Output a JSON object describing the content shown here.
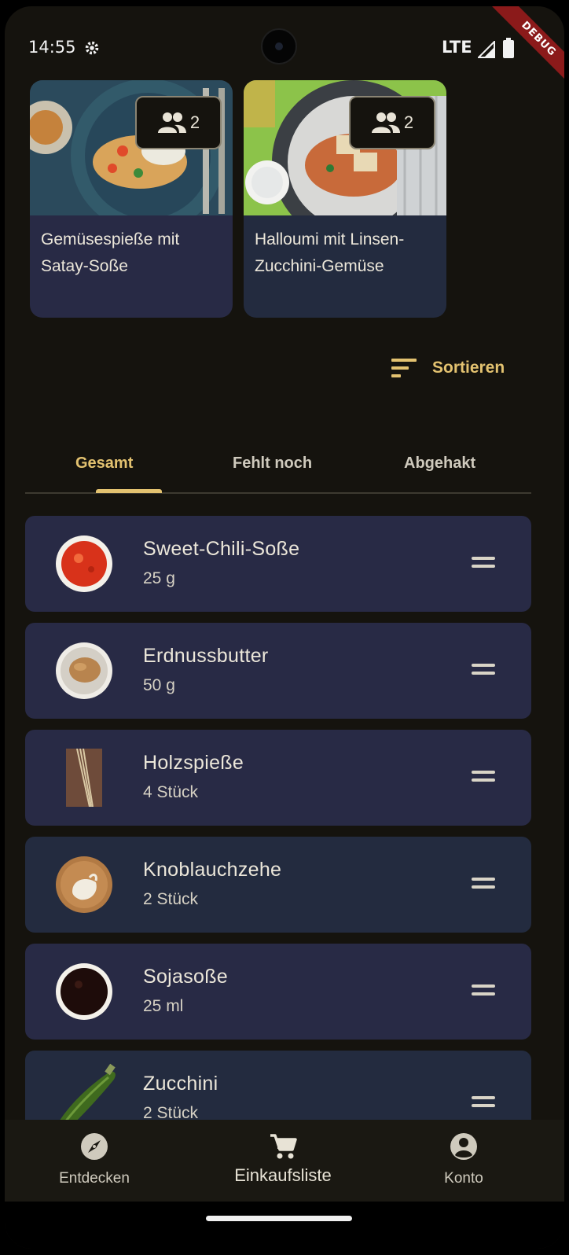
{
  "status_bar": {
    "time": "14:55",
    "network": "LTE",
    "debug_banner": "DEBUG"
  },
  "recipes": [
    {
      "title": "Gemüsespieße mit Satay-Soße",
      "servings": "2"
    },
    {
      "title": "Halloumi mit Linsen-Zucchini-Gemüse",
      "servings": "2"
    }
  ],
  "sort": {
    "label": "Sortieren",
    "icon": "sort-icon"
  },
  "tabs": [
    {
      "label": "Gesamt",
      "active": true
    },
    {
      "label": "Fehlt noch",
      "active": false
    },
    {
      "label": "Abgehakt",
      "active": false
    }
  ],
  "ingredients": [
    {
      "name": "Sweet-Chili-Soße",
      "quantity": "25 g"
    },
    {
      "name": "Erdnussbutter",
      "quantity": "50 g"
    },
    {
      "name": "Holzspieße",
      "quantity": "4 Stück"
    },
    {
      "name": "Knoblauchzehe",
      "quantity": "2 Stück"
    },
    {
      "name": "Sojasoße",
      "quantity": "25 ml"
    },
    {
      "name": "Zucchini",
      "quantity": "2 Stück"
    }
  ],
  "bottom_nav": [
    {
      "label": "Entdecken",
      "icon": "compass-icon"
    },
    {
      "label": "Einkaufsliste",
      "icon": "cart-icon",
      "active": true
    },
    {
      "label": "Konto",
      "icon": "account-icon"
    }
  ],
  "colors": {
    "accent": "#e3c270",
    "background": "#15130e",
    "card": "#282a45",
    "card_alt": "#232b3f"
  }
}
